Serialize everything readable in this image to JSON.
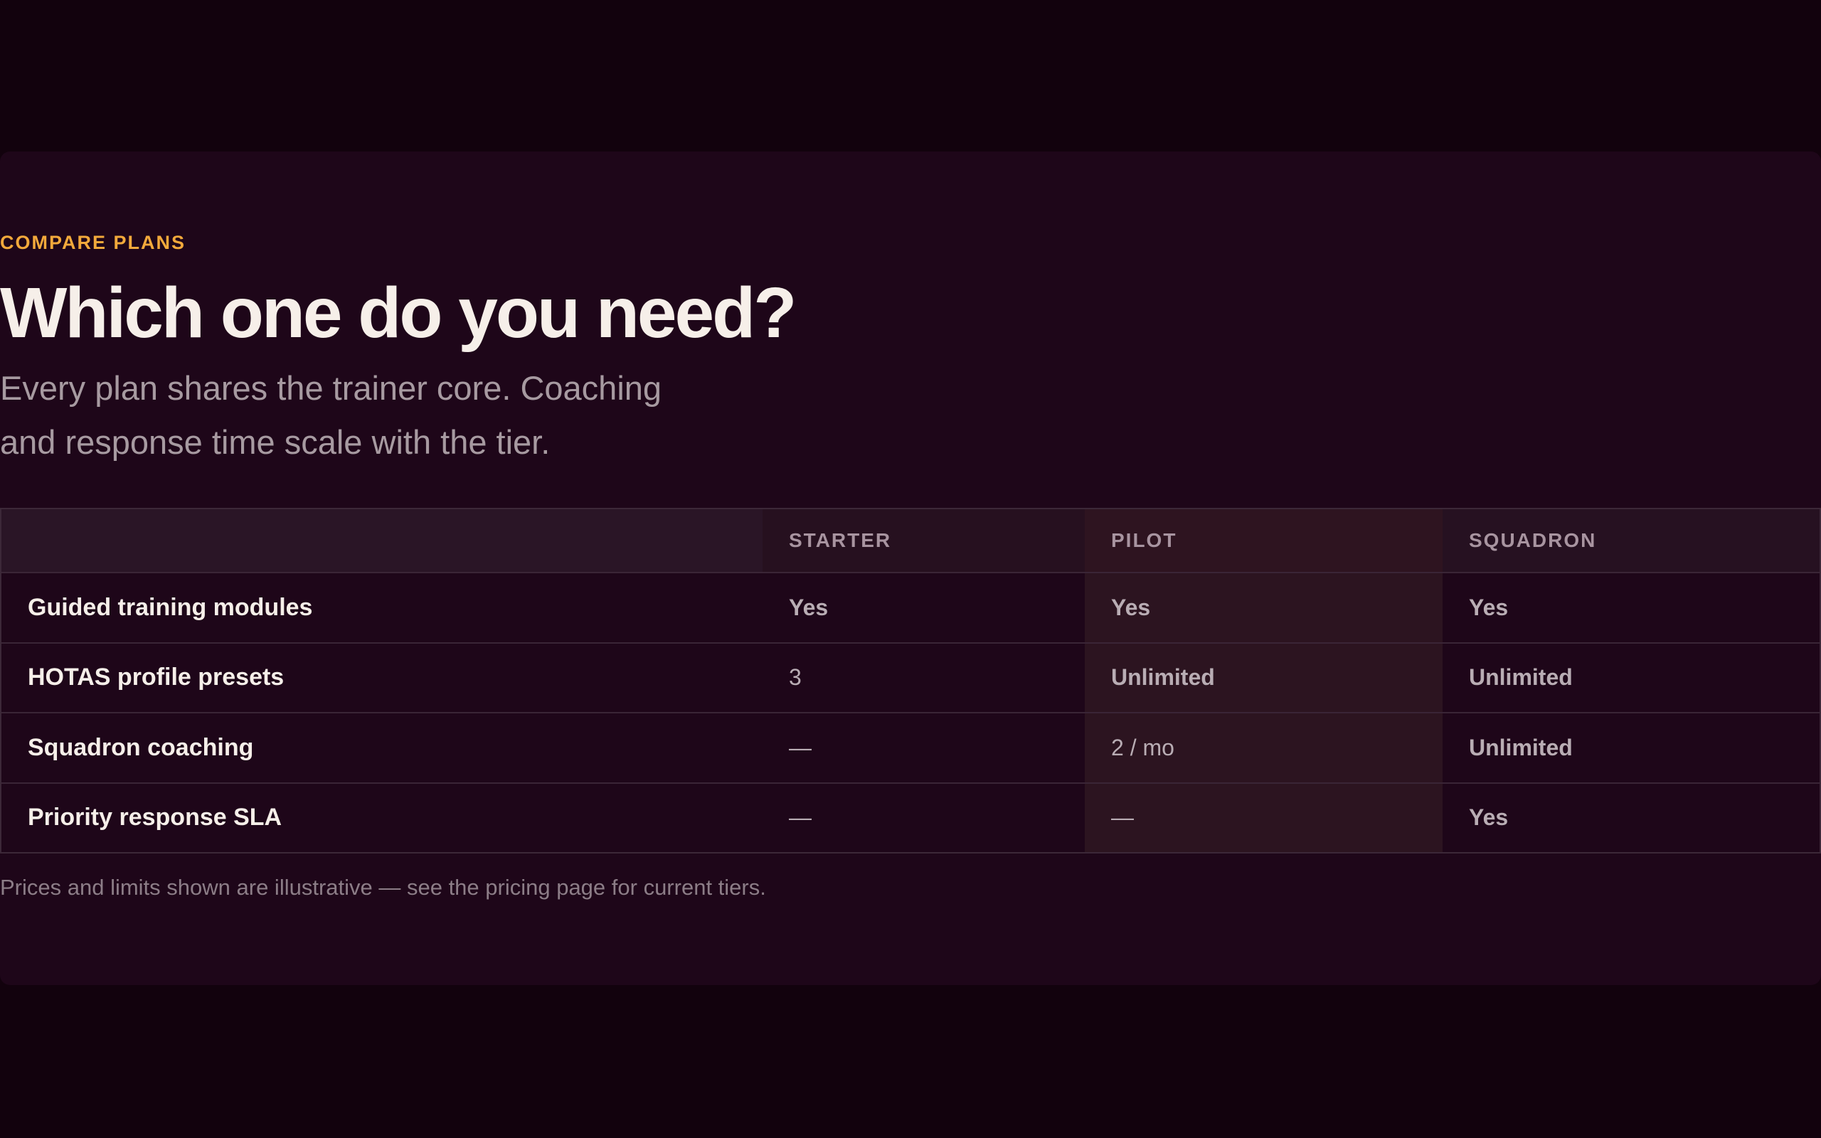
{
  "compare": {
    "eyebrow": "COMPARE PLANS",
    "title": "Which one do you need?",
    "lead": "Every plan shares the trainer core. Coaching and response time scale with the tier.",
    "footnote": "Prices and limits shown are illustrative — see the pricing page for current tiers."
  },
  "table": {
    "columns": [
      "",
      "STARTER",
      "PILOT",
      "SQUADRON"
    ],
    "highlighted_column": "PILOT",
    "rows": [
      {
        "feature": "Guided training modules",
        "starter": "Yes",
        "pilot": "Yes",
        "squadron": "Yes"
      },
      {
        "feature": "HOTAS profile presets",
        "starter": "3",
        "pilot": "Unlimited",
        "squadron": "Unlimited"
      },
      {
        "feature": "Squadron coaching",
        "starter": "—",
        "pilot": "2 / mo",
        "squadron": "Unlimited"
      },
      {
        "feature": "Priority response SLA",
        "starter": "—",
        "pilot": "—",
        "squadron": "Yes"
      }
    ]
  },
  "colors": {
    "page_background": "#12020d",
    "section_background": "#1e0619",
    "accent": "#f2a93b",
    "heading": "#f6efe9",
    "muted_text": "#a79aa1",
    "highlight_column": "#2c1420"
  }
}
